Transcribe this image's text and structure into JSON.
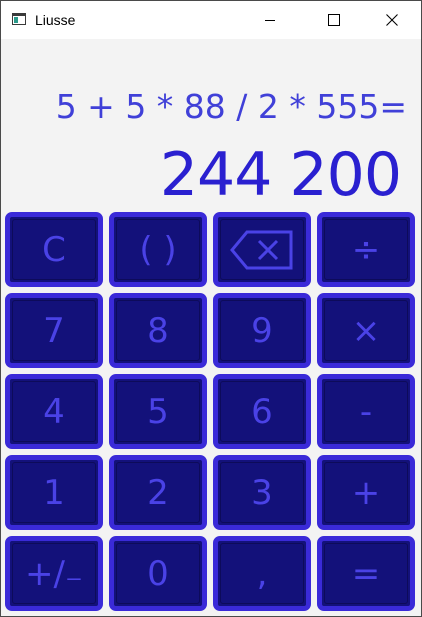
{
  "window": {
    "title": "Liusse",
    "icon": "window-app-icon",
    "controls": {
      "minimize_icon": "minimize-icon",
      "maximize_icon": "maximize-icon",
      "close_icon": "close-icon"
    }
  },
  "display": {
    "expression": "5 + 5 * 88 / 2 * 555=",
    "result": "244 200"
  },
  "keypad": {
    "rows": [
      [
        {
          "name": "clear-button",
          "label": "C"
        },
        {
          "name": "parentheses-button",
          "label": "( )"
        },
        {
          "name": "backspace-button",
          "label": "",
          "icon": "backspace-icon"
        },
        {
          "name": "divide-button",
          "label": "÷"
        }
      ],
      [
        {
          "name": "digit-7-button",
          "label": "7"
        },
        {
          "name": "digit-8-button",
          "label": "8"
        },
        {
          "name": "digit-9-button",
          "label": "9"
        },
        {
          "name": "multiply-button",
          "label": "×"
        }
      ],
      [
        {
          "name": "digit-4-button",
          "label": "4"
        },
        {
          "name": "digit-5-button",
          "label": "5"
        },
        {
          "name": "digit-6-button",
          "label": "6"
        },
        {
          "name": "minus-button",
          "label": "-"
        }
      ],
      [
        {
          "name": "digit-1-button",
          "label": "1"
        },
        {
          "name": "digit-2-button",
          "label": "2"
        },
        {
          "name": "digit-3-button",
          "label": "3"
        },
        {
          "name": "plus-button",
          "label": "+"
        }
      ],
      [
        {
          "name": "plus-minus-button",
          "label": "+∕₋"
        },
        {
          "name": "digit-0-button",
          "label": "0"
        },
        {
          "name": "decimal-comma-button",
          "label": ","
        },
        {
          "name": "equals-button",
          "label": "="
        }
      ]
    ]
  },
  "colors": {
    "key_background": "#13117a",
    "key_border": "#3a2ad8",
    "key_text": "#4a42e6",
    "expression_text": "#4040d8",
    "result_text": "#2a20d0",
    "display_background": "#f3f3f3"
  }
}
